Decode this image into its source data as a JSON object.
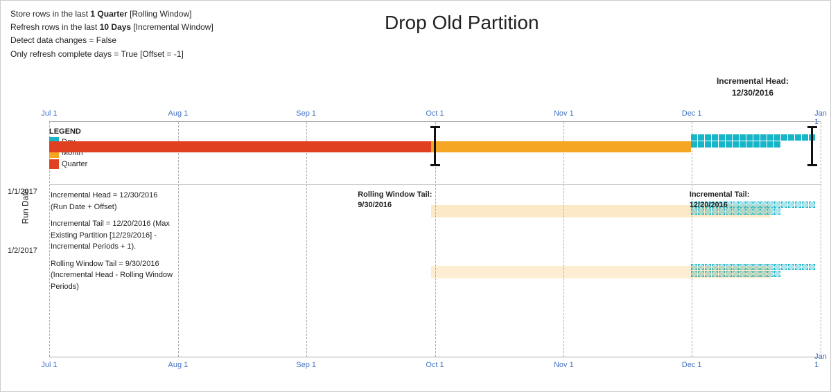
{
  "title": "Drop Old Partition",
  "info": {
    "line1_prefix": "Store rows in the last ",
    "line1_bold": "1 Quarter",
    "line1_suffix": " [Rolling Window]",
    "line2_prefix": "Refresh rows in the last ",
    "line2_bold": "10 Days",
    "line2_suffix": " [Incremental Window]",
    "line3": "Detect data changes = False",
    "line4": "Only refresh complete days = True [Offset = -1]"
  },
  "inc_head_label": "Incremental Head:\n12/30/2016",
  "legend": {
    "title": "LEGEND",
    "items": [
      {
        "label": "Day",
        "color": "#17b5c8"
      },
      {
        "label": "Month",
        "color": "#f5a623"
      },
      {
        "label": "Quarter",
        "color": "#e04020"
      }
    ]
  },
  "axis": {
    "labels": [
      "Jul 1",
      "Aug 1",
      "Sep 1",
      "Oct 1",
      "Nov 1",
      "Dec 1",
      "Jan 1"
    ]
  },
  "annotations": {
    "inc_head": "Incremental Head = 12/30/2016\n(Run Date + Offset)",
    "inc_tail": "Incremental Tail = 12/20/2016 (Max\nExisting Partition [12/29/2016] -\nIncremental Periods + 1).",
    "rolling_tail": "Rolling Window Tail = 9/30/2016\n(Incremental Head - Rolling Window\nPeriods)",
    "rolling_window_tail_label": "Rolling Window Tail:\n9/30/2016",
    "incremental_tail_label": "Incremental Tail:\n12/20/2016",
    "run_date": "Run Date",
    "row1_date": "1/1/2017",
    "row2_date": "1/2/2017"
  }
}
